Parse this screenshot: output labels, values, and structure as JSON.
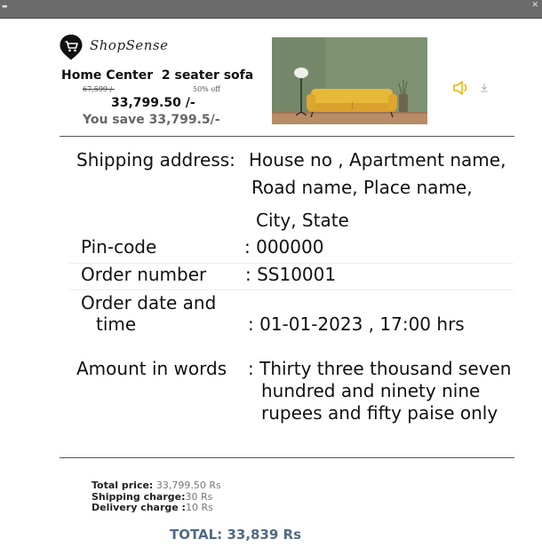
{
  "brand": {
    "name": "ShopSense"
  },
  "product": {
    "name": "Home Center  2 seater sofa",
    "mrp": "67,599 /-",
    "discount": "50% off",
    "price": "33,799.50 /-",
    "savings": "You save 33,799.5/-"
  },
  "shipping": {
    "label": "Shipping address:",
    "line1": "House no , Apartment name,",
    "line2": "Road name, Place name,",
    "line3": "City, State"
  },
  "pincode": {
    "label": "Pin-code",
    "value": ": 000000"
  },
  "order_number": {
    "label": "Order number",
    "value": ": SS10001"
  },
  "order_date": {
    "label_line1": "Order date and",
    "label_line2": "time",
    "value": ": 01-01-2023 , 17:00 hrs"
  },
  "amount_words": {
    "label": "Amount in words",
    "line1": ": Thirty three thousand seven",
    "line2": "hundred and ninety nine",
    "line3": "rupees and fifty paise only"
  },
  "totals": {
    "total_price_label": "Total price:",
    "total_price_value": " 33,799.50 Rs",
    "shipping_label": "Shipping charge:",
    "shipping_value": "30 Rs",
    "delivery_label": "Delivery charge :",
    "delivery_value": "10 Rs",
    "grand_total": "TOTAL: 33,839 Rs"
  },
  "icons": {
    "logo": "shopping-cart-pin-icon",
    "speaker": "speaker-icon",
    "download": "download-icon"
  },
  "colors": {
    "speaker": "#f0b400",
    "sofa": "#e8b838",
    "wall": "#7c8f70",
    "grand_total": "#4f6a85"
  }
}
